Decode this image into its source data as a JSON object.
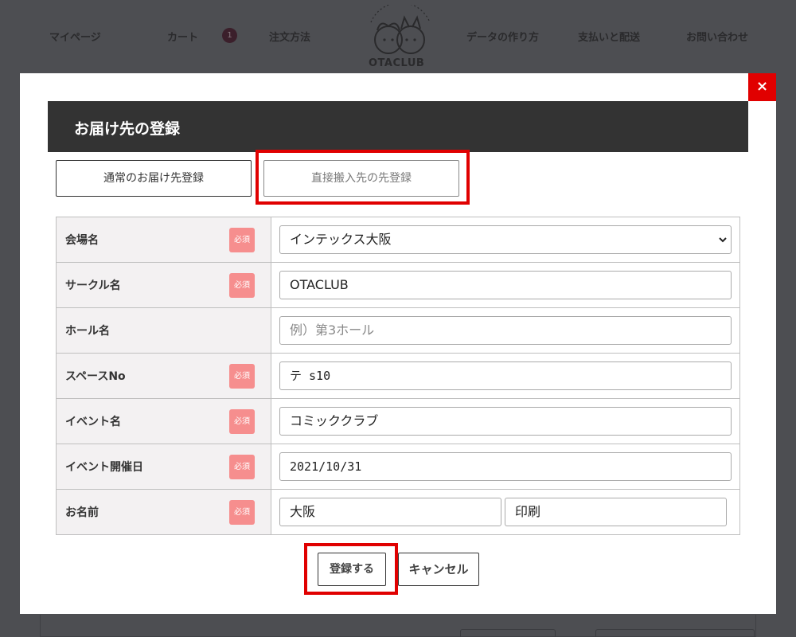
{
  "nav": {
    "items": [
      "マイページ",
      "カート",
      "注文方法",
      "データの作り方",
      "支払いと配送",
      "お問い合わせ"
    ],
    "cart_count": "1",
    "logo_text": "OTACLUB"
  },
  "modal": {
    "title": "お届け先の登録",
    "close_label": "×",
    "tabs": {
      "normal": "通常のお届け先登録",
      "direct": "直接搬入先の先登録"
    },
    "required_label": "必須",
    "fields": {
      "venue": {
        "label": "会場名",
        "value": "インテックス大阪",
        "required": true
      },
      "circle": {
        "label": "サークル名",
        "value": "OTACLUB",
        "required": true
      },
      "hall": {
        "label": "ホール名",
        "placeholder": "例）第3ホール",
        "required": false
      },
      "space": {
        "label": "スペースNo",
        "value": "テ s10",
        "required": true
      },
      "event": {
        "label": "イベント名",
        "value": "コミッククラブ",
        "required": true
      },
      "date": {
        "label": "イベント開催日",
        "value": "2021/10/31",
        "required": true
      },
      "name": {
        "label": "お名前",
        "last": "大阪",
        "first": "印刷",
        "required": true
      }
    },
    "submit_label": "登録する",
    "cancel_label": "キャンセル"
  },
  "colors": {
    "overlay": "#4d4e52",
    "header_bg": "#333333",
    "close_bg": "#e10000",
    "required_badge": "#f68e8e",
    "highlight": "#e00000"
  }
}
